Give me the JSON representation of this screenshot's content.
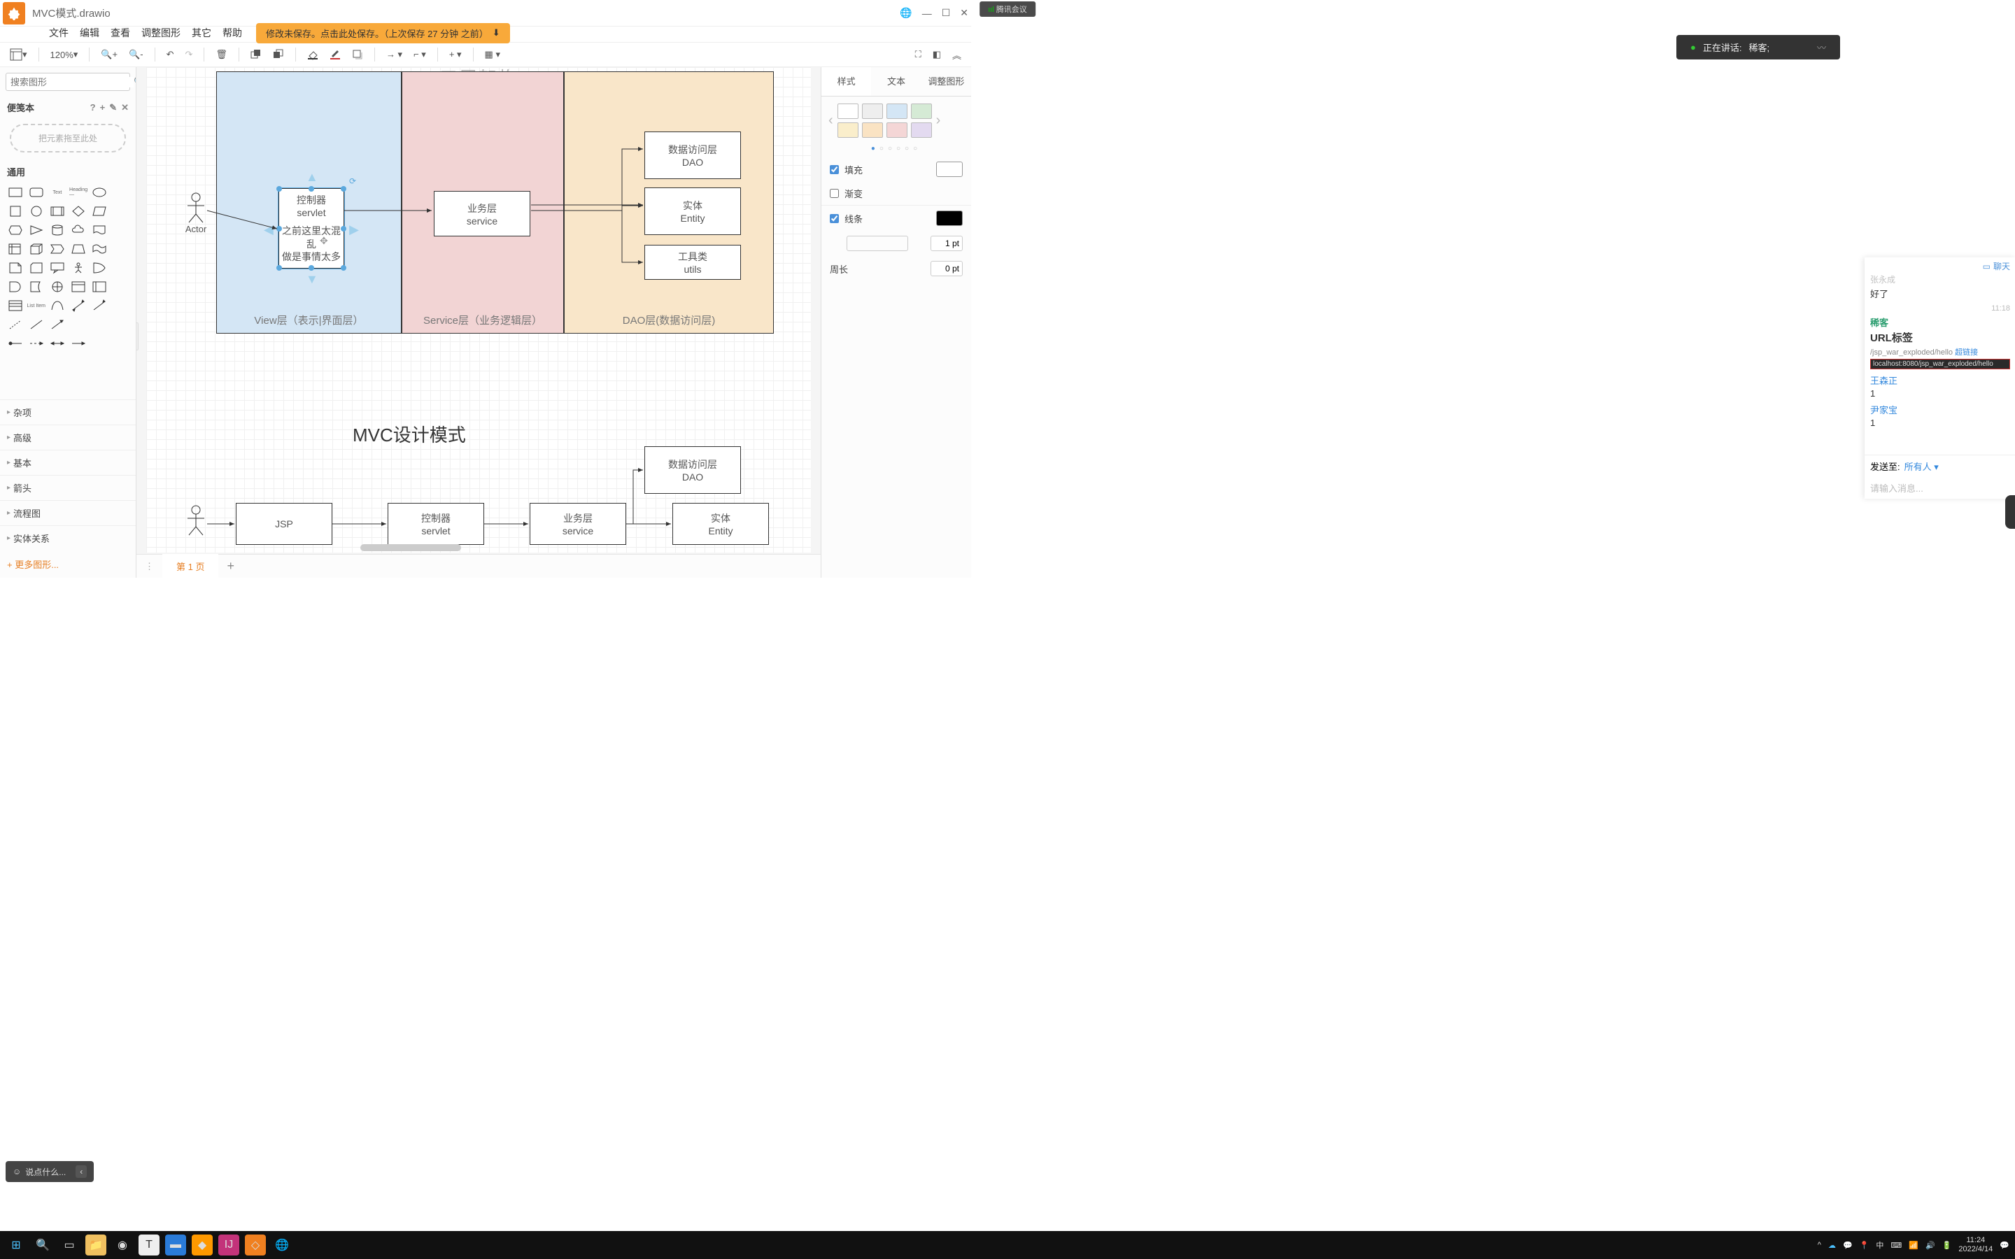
{
  "meeting_pill": "腾讯会议",
  "title": "MVC模式.drawio",
  "title_controls": {
    "globe": "🌐",
    "min": "—",
    "max": "☐",
    "close": "✕"
  },
  "menu": [
    "文件",
    "编辑",
    "查看",
    "调整图形",
    "其它",
    "帮助"
  ],
  "save_msg": "修改未保存。点击此处保存。（上次保存 27 分钟 之前）",
  "speaking": {
    "label": "正在讲话:",
    "name": "稀客;"
  },
  "toolbar": {
    "zoom": "120%"
  },
  "left": {
    "search_placeholder": "搜索图形",
    "notepad": "便笺本",
    "drop_text": "把元素拖至此处",
    "section_general": "通用",
    "categories": [
      "杂项",
      "高级",
      "基本",
      "箭头",
      "流程图",
      "实体关系"
    ],
    "more": "+ 更多图形..."
  },
  "right": {
    "tabs": [
      "样式",
      "文本",
      "调整图形"
    ],
    "fill": "填充",
    "gradient": "渐变",
    "line": "线条",
    "perimeter": "周长",
    "line_width": "1 pt",
    "perimeter_val": "0 pt"
  },
  "canvas": {
    "top_title": "三层架构",
    "layers": {
      "view": "View层（表示|界面层）",
      "service": "Service层（业务逻辑层）",
      "dao": "DAO层(数据访问层)"
    },
    "actor": "Actor",
    "selected_box": {
      "l1": "控制器",
      "l2": "servlet",
      "l3": "之前这里太混乱",
      "l4": "做是事情太多"
    },
    "service_box": {
      "l1": "业务层",
      "l2": "service"
    },
    "dao_box": {
      "l1": "数据访问层",
      "l2": "DAO"
    },
    "entity_box": {
      "l1": "实体",
      "l2": "Entity"
    },
    "utils_box": {
      "l1": "工具类",
      "l2": "utils"
    },
    "mvc_title": "MVC设计模式",
    "jsp_box": "JSP",
    "ctrl_box": {
      "l1": "控制器",
      "l2": "servlet"
    },
    "svc_box": {
      "l1": "业务层",
      "l2": "service"
    },
    "dao2_box": {
      "l1": "数据访问层",
      "l2": "DAO"
    },
    "entity2_box": {
      "l1": "实体",
      "l2": "Entity"
    }
  },
  "chat": {
    "header": "聊天",
    "user1": "张永成",
    "msg1": "好了",
    "time1": "11:18",
    "user_xike": "稀客",
    "snippet_title": "URL标签",
    "url1_a": "/jsp_war_exploded/hello ",
    "url1_b": "超链接",
    "url2": "localhost:8080/jsp_war_exploded/hello",
    "user3": "王森正",
    "msg3": "1",
    "user4": "尹家宝",
    "msg4": "1",
    "send_to": "发送至:",
    "send_target": "所有人 ▾",
    "input_placeholder": "请输入消息..."
  },
  "input_helper": "说点什么...",
  "page_tab": "第 1 页",
  "tray": {
    "time": "11:24",
    "date": "2022/4/14",
    "ime": "中"
  }
}
